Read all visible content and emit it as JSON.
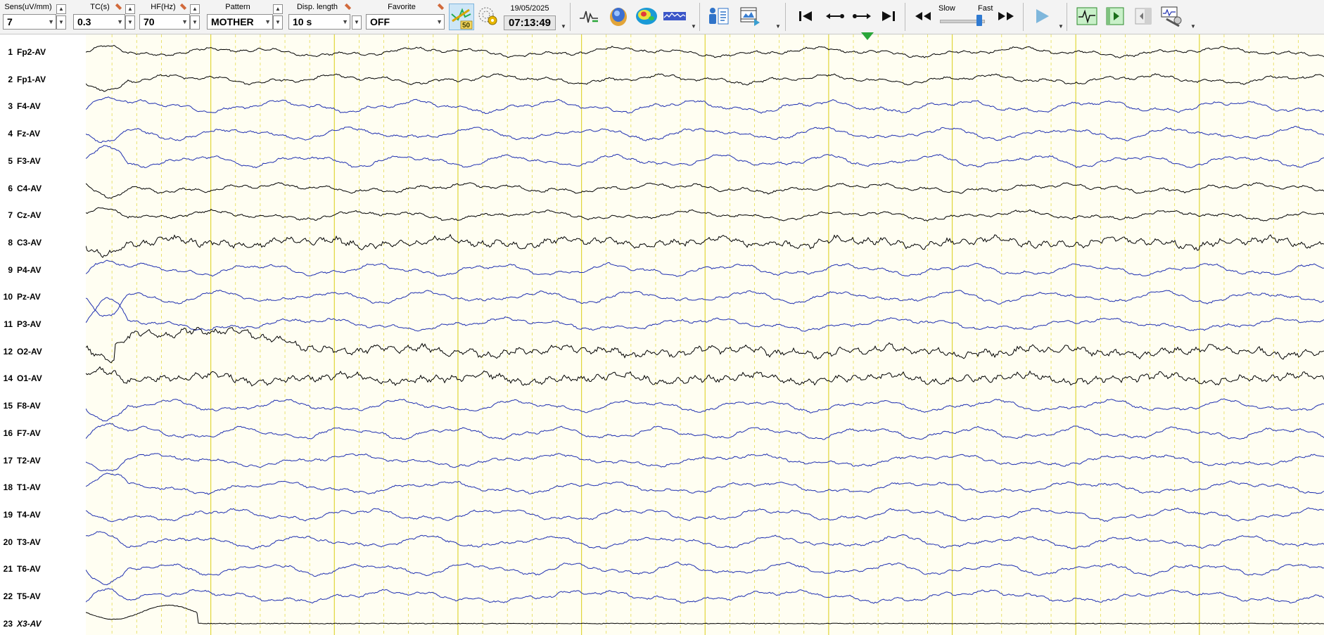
{
  "toolbar": {
    "sens": {
      "label": "Sens(uV/mm)",
      "value": "7"
    },
    "tc": {
      "label": "TC(s)",
      "value": "0.3"
    },
    "hf": {
      "label": "HF(Hz)",
      "value": "70"
    },
    "pattern": {
      "label": "Pattern",
      "value": "MOTHER"
    },
    "disp_length": {
      "label": "Disp. length",
      "value": "10 s"
    },
    "favorite": {
      "label": "Favorite",
      "value": "OFF"
    },
    "date": "19/05/2025",
    "time": "07:13:49",
    "badge_50": "50",
    "speed": {
      "slow_label": "Slow",
      "fast_label": "Fast",
      "level": 0.9
    },
    "colors": {
      "accent_selected": "#cde6f7",
      "marker": "#2aa63a"
    },
    "icons": [
      "notch-filter-icon",
      "grid-settings-icon",
      "waveform-icon",
      "head-map-icon",
      "topography-map-icon",
      "spectrum-bar-icon",
      "patient-info-icon",
      "video-icon",
      "go-first-icon",
      "step-back-icon",
      "step-forward-icon",
      "go-last-icon",
      "rewind-icon",
      "fast-forward-icon",
      "play-icon",
      "monitor-waveform-icon",
      "play-segment-icon",
      "toggle-panel-icon",
      "device-settings-icon"
    ]
  },
  "channels": [
    {
      "num": "1",
      "name": "Fp2-AV",
      "color": "#000000"
    },
    {
      "num": "2",
      "name": "Fp1-AV",
      "color": "#000000"
    },
    {
      "num": "3",
      "name": "F4-AV",
      "color": "#1f2fb0"
    },
    {
      "num": "4",
      "name": "Fz-AV",
      "color": "#1f2fb0"
    },
    {
      "num": "5",
      "name": "F3-AV",
      "color": "#1f2fb0"
    },
    {
      "num": "6",
      "name": "C4-AV",
      "color": "#000000"
    },
    {
      "num": "7",
      "name": "Cz-AV",
      "color": "#000000"
    },
    {
      "num": "8",
      "name": "C3-AV",
      "color": "#000000"
    },
    {
      "num": "9",
      "name": "P4-AV",
      "color": "#1f2fb0"
    },
    {
      "num": "10",
      "name": "Pz-AV",
      "color": "#1f2fb0"
    },
    {
      "num": "11",
      "name": "P3-AV",
      "color": "#1f2fb0"
    },
    {
      "num": "12",
      "name": "O2-AV",
      "color": "#000000"
    },
    {
      "num": "14",
      "name": "O1-AV",
      "color": "#000000"
    },
    {
      "num": "15",
      "name": "F8-AV",
      "color": "#1f2fb0"
    },
    {
      "num": "16",
      "name": "F7-AV",
      "color": "#1f2fb0"
    },
    {
      "num": "17",
      "name": "T2-AV",
      "color": "#1f2fb0"
    },
    {
      "num": "18",
      "name": "T1-AV",
      "color": "#1f2fb0"
    },
    {
      "num": "19",
      "name": "T4-AV",
      "color": "#1f2fb0"
    },
    {
      "num": "20",
      "name": "T3-AV",
      "color": "#1f2fb0"
    },
    {
      "num": "21",
      "name": "T6-AV",
      "color": "#1f2fb0"
    },
    {
      "num": "22",
      "name": "T5-AV",
      "color": "#1f2fb0"
    },
    {
      "num": "23",
      "name": "X3-AV",
      "color": "#000000",
      "italic": true
    }
  ],
  "display": {
    "seconds": 10,
    "background": "#fffef2",
    "grid_color": "#e0d63a"
  }
}
